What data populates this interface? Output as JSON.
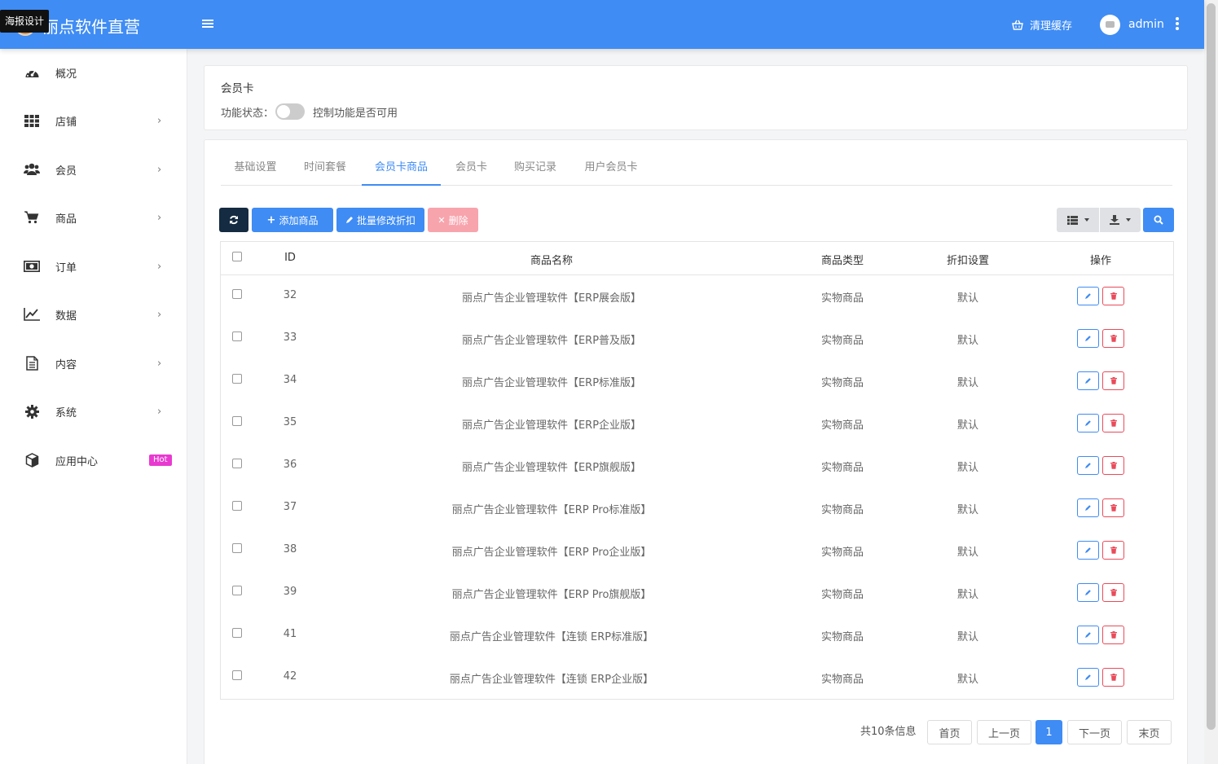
{
  "tooltip": "海报设计",
  "brand": {
    "title": "丽点软件直营"
  },
  "header": {
    "clear_cache": "清理缓存",
    "user": "admin"
  },
  "sidebar": {
    "items": [
      {
        "label": "概况",
        "icon": "dashboard-icon",
        "arrow": ""
      },
      {
        "label": "店铺",
        "icon": "grid-icon",
        "arrow": "›"
      },
      {
        "label": "会员",
        "icon": "users-icon",
        "arrow": "›"
      },
      {
        "label": "商品",
        "icon": "cart-icon",
        "arrow": "›"
      },
      {
        "label": "订单",
        "icon": "money-icon",
        "arrow": "›"
      },
      {
        "label": "数据",
        "icon": "chart-icon",
        "arrow": "›"
      },
      {
        "label": "内容",
        "icon": "document-icon",
        "arrow": "›"
      },
      {
        "label": "系统",
        "icon": "gear-icon",
        "arrow": "›"
      },
      {
        "label": "应用中心",
        "icon": "cube-icon",
        "arrow": ""
      }
    ],
    "hot_badge": "Hot"
  },
  "feature": {
    "title": "会员卡",
    "status_label": "功能状态：",
    "status_desc": "控制功能是否可用",
    "enabled": false
  },
  "tabs": [
    "基础设置",
    "时间套餐",
    "会员卡商品",
    "会员卡",
    "购买记录",
    "用户会员卡"
  ],
  "active_tab": "会员卡商品",
  "toolbar": {
    "refresh_icon": "refresh-icon",
    "add_label": "添加商品",
    "batch_label": "批量修改折扣",
    "delete_label": "删除"
  },
  "table": {
    "headers": {
      "id": "ID",
      "name": "商品名称",
      "type": "商品类型",
      "discount": "折扣设置",
      "ops": "操作"
    },
    "rows": [
      {
        "id": "32",
        "name": "丽点广告企业管理软件【ERP展会版】",
        "type": "实物商品",
        "discount": "默认"
      },
      {
        "id": "33",
        "name": "丽点广告企业管理软件【ERP普及版】",
        "type": "实物商品",
        "discount": "默认"
      },
      {
        "id": "34",
        "name": "丽点广告企业管理软件【ERP标准版】",
        "type": "实物商品",
        "discount": "默认"
      },
      {
        "id": "35",
        "name": "丽点广告企业管理软件【ERP企业版】",
        "type": "实物商品",
        "discount": "默认"
      },
      {
        "id": "36",
        "name": "丽点广告企业管理软件【ERP旗舰版】",
        "type": "实物商品",
        "discount": "默认"
      },
      {
        "id": "37",
        "name": "丽点广告企业管理软件【ERP Pro标准版】",
        "type": "实物商品",
        "discount": "默认"
      },
      {
        "id": "38",
        "name": "丽点广告企业管理软件【ERP Pro企业版】",
        "type": "实物商品",
        "discount": "默认"
      },
      {
        "id": "39",
        "name": "丽点广告企业管理软件【ERP Pro旗舰版】",
        "type": "实物商品",
        "discount": "默认"
      },
      {
        "id": "41",
        "name": "丽点广告企业管理软件【连锁 ERP标准版】",
        "type": "实物商品",
        "discount": "默认"
      },
      {
        "id": "42",
        "name": "丽点广告企业管理软件【连锁 ERP企业版】",
        "type": "实物商品",
        "discount": "默认"
      }
    ]
  },
  "pagination": {
    "info": "共10条信息",
    "first": "首页",
    "prev": "上一页",
    "current": "1",
    "next": "下一页",
    "last": "末页"
  },
  "colors": {
    "primary": "#3f8cf4",
    "danger": "#e94b5a",
    "dark": "#142b41",
    "hot": "#e83ad0"
  }
}
